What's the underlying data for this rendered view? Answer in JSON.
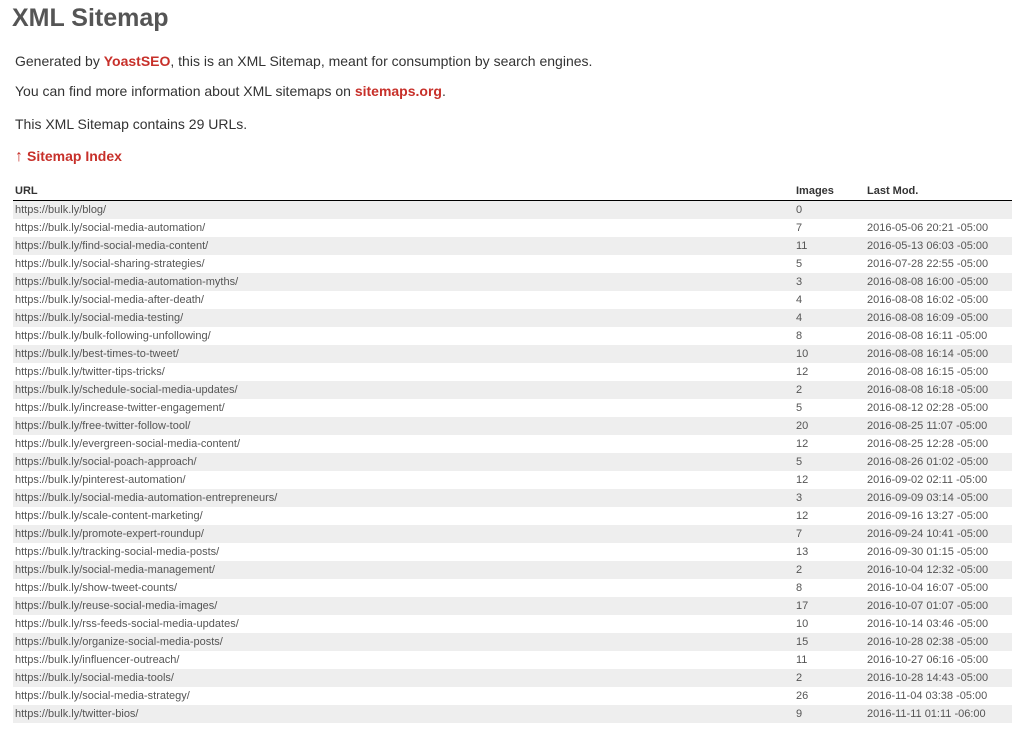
{
  "title": "XML Sitemap",
  "intro": {
    "generated_prefix": "Generated by ",
    "generator_link": "YoastSEO",
    "generated_suffix": ", this is an XML Sitemap, meant for consumption by search engines.",
    "info_prefix": "You can find more information about XML sitemaps on ",
    "info_link": "sitemaps.org",
    "info_suffix": ".",
    "count_text": "This XML Sitemap contains 29 URLs."
  },
  "index_link": {
    "arrow": "↑",
    "label": "Sitemap Index"
  },
  "table": {
    "headers": {
      "url": "URL",
      "images": "Images",
      "lastmod": "Last Mod."
    },
    "rows": [
      {
        "url": "https://bulk.ly/blog/",
        "images": "0",
        "lastmod": ""
      },
      {
        "url": "https://bulk.ly/social-media-automation/",
        "images": "7",
        "lastmod": "2016-05-06 20:21 -05:00"
      },
      {
        "url": "https://bulk.ly/find-social-media-content/",
        "images": "11",
        "lastmod": "2016-05-13 06:03 -05:00"
      },
      {
        "url": "https://bulk.ly/social-sharing-strategies/",
        "images": "5",
        "lastmod": "2016-07-28 22:55 -05:00"
      },
      {
        "url": "https://bulk.ly/social-media-automation-myths/",
        "images": "3",
        "lastmod": "2016-08-08 16:00 -05:00"
      },
      {
        "url": "https://bulk.ly/social-media-after-death/",
        "images": "4",
        "lastmod": "2016-08-08 16:02 -05:00"
      },
      {
        "url": "https://bulk.ly/social-media-testing/",
        "images": "4",
        "lastmod": "2016-08-08 16:09 -05:00"
      },
      {
        "url": "https://bulk.ly/bulk-following-unfollowing/",
        "images": "8",
        "lastmod": "2016-08-08 16:11 -05:00"
      },
      {
        "url": "https://bulk.ly/best-times-to-tweet/",
        "images": "10",
        "lastmod": "2016-08-08 16:14 -05:00"
      },
      {
        "url": "https://bulk.ly/twitter-tips-tricks/",
        "images": "12",
        "lastmod": "2016-08-08 16:15 -05:00"
      },
      {
        "url": "https://bulk.ly/schedule-social-media-updates/",
        "images": "2",
        "lastmod": "2016-08-08 16:18 -05:00"
      },
      {
        "url": "https://bulk.ly/increase-twitter-engagement/",
        "images": "5",
        "lastmod": "2016-08-12 02:28 -05:00"
      },
      {
        "url": "https://bulk.ly/free-twitter-follow-tool/",
        "images": "20",
        "lastmod": "2016-08-25 11:07 -05:00"
      },
      {
        "url": "https://bulk.ly/evergreen-social-media-content/",
        "images": "12",
        "lastmod": "2016-08-25 12:28 -05:00"
      },
      {
        "url": "https://bulk.ly/social-poach-approach/",
        "images": "5",
        "lastmod": "2016-08-26 01:02 -05:00"
      },
      {
        "url": "https://bulk.ly/pinterest-automation/",
        "images": "12",
        "lastmod": "2016-09-02 02:11 -05:00"
      },
      {
        "url": "https://bulk.ly/social-media-automation-entrepreneurs/",
        "images": "3",
        "lastmod": "2016-09-09 03:14 -05:00"
      },
      {
        "url": "https://bulk.ly/scale-content-marketing/",
        "images": "12",
        "lastmod": "2016-09-16 13:27 -05:00"
      },
      {
        "url": "https://bulk.ly/promote-expert-roundup/",
        "images": "7",
        "lastmod": "2016-09-24 10:41 -05:00"
      },
      {
        "url": "https://bulk.ly/tracking-social-media-posts/",
        "images": "13",
        "lastmod": "2016-09-30 01:15 -05:00"
      },
      {
        "url": "https://bulk.ly/social-media-management/",
        "images": "2",
        "lastmod": "2016-10-04 12:32 -05:00"
      },
      {
        "url": "https://bulk.ly/show-tweet-counts/",
        "images": "8",
        "lastmod": "2016-10-04 16:07 -05:00"
      },
      {
        "url": "https://bulk.ly/reuse-social-media-images/",
        "images": "17",
        "lastmod": "2016-10-07 01:07 -05:00"
      },
      {
        "url": "https://bulk.ly/rss-feeds-social-media-updates/",
        "images": "10",
        "lastmod": "2016-10-14 03:46 -05:00"
      },
      {
        "url": "https://bulk.ly/organize-social-media-posts/",
        "images": "15",
        "lastmod": "2016-10-28 02:38 -05:00"
      },
      {
        "url": "https://bulk.ly/influencer-outreach/",
        "images": "11",
        "lastmod": "2016-10-27 06:16 -05:00"
      },
      {
        "url": "https://bulk.ly/social-media-tools/",
        "images": "2",
        "lastmod": "2016-10-28 14:43 -05:00"
      },
      {
        "url": "https://bulk.ly/social-media-strategy/",
        "images": "26",
        "lastmod": "2016-11-04 03:38 -05:00"
      },
      {
        "url": "https://bulk.ly/twitter-bios/",
        "images": "9",
        "lastmod": "2016-11-11 01:11 -06:00"
      }
    ]
  },
  "colors": {
    "link": "#c7302a",
    "heading": "#555555",
    "text": "#333333",
    "row_alt": "#eeeeee"
  }
}
